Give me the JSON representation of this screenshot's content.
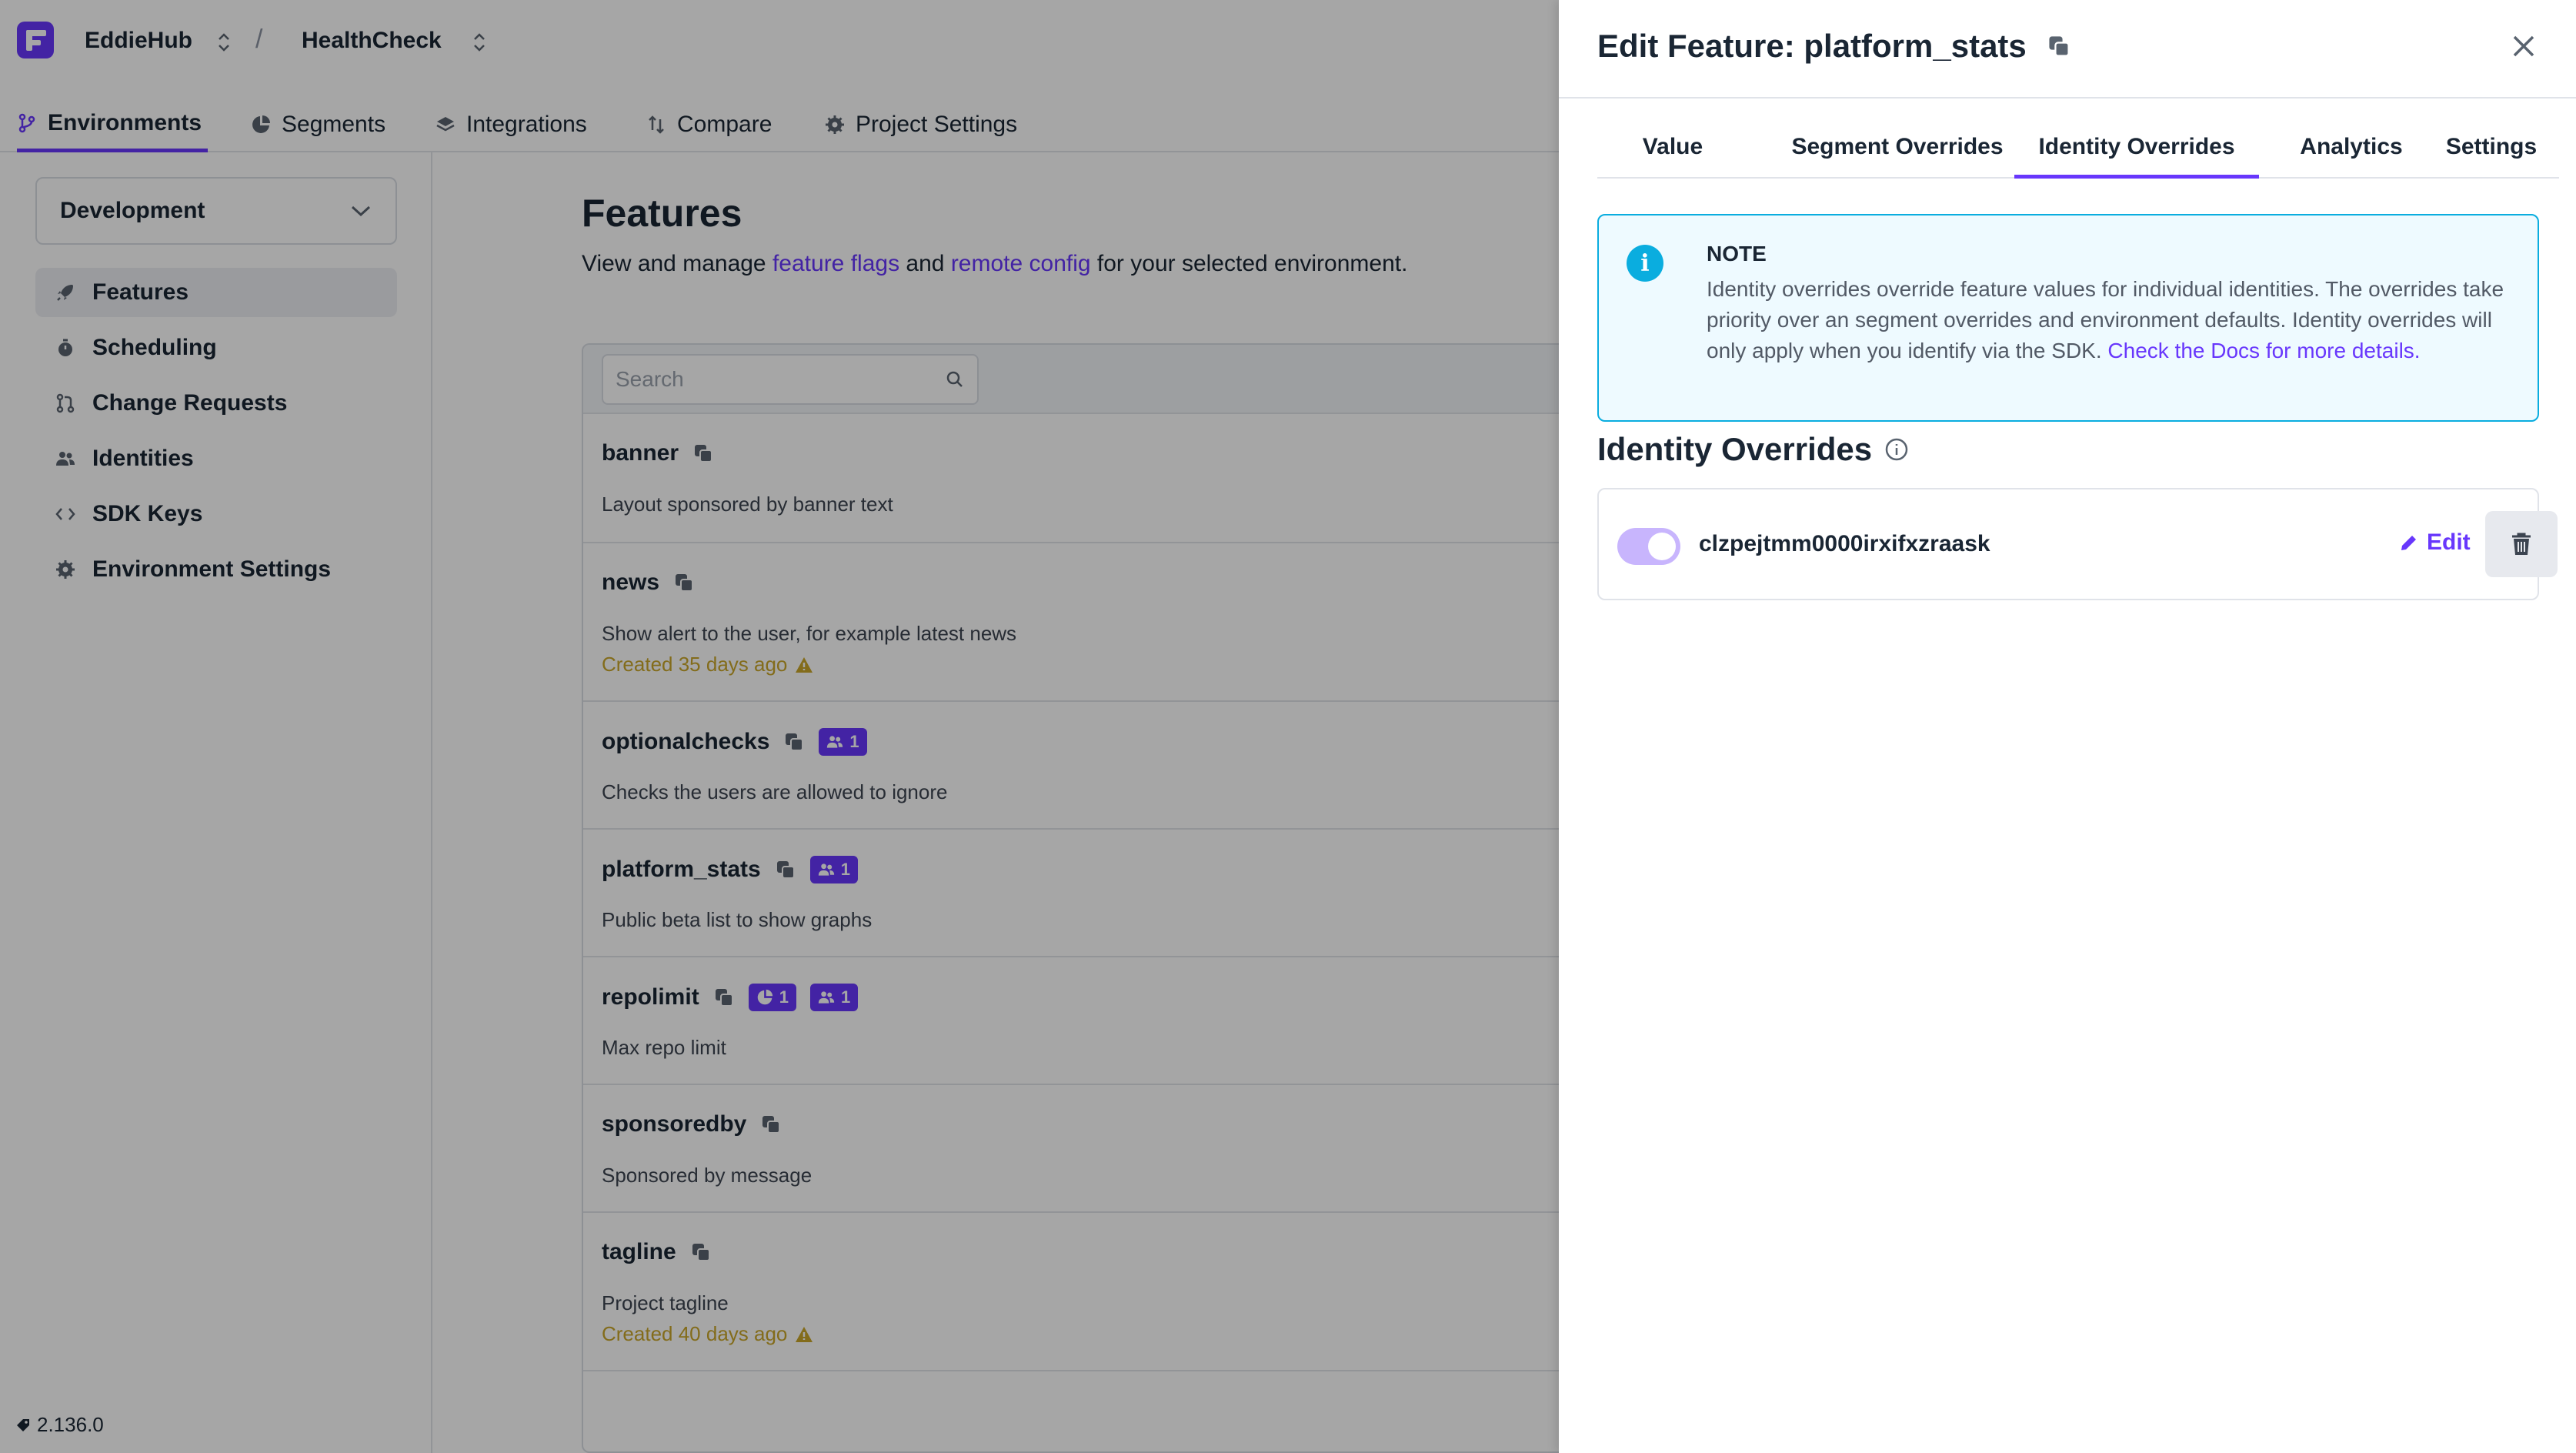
{
  "topbar": {
    "org": "EddieHub",
    "separator": "/",
    "project": "HealthCheck"
  },
  "nav": {
    "tabs": [
      {
        "label": "Environments",
        "icon": "git-branch-icon"
      },
      {
        "label": "Segments",
        "icon": "pie-chart-icon"
      },
      {
        "label": "Integrations",
        "icon": "layers-icon"
      },
      {
        "label": "Compare",
        "icon": "compare-icon"
      },
      {
        "label": "Project Settings",
        "icon": "gear-icon"
      }
    ]
  },
  "sidebar": {
    "environment": "Development",
    "items": [
      {
        "label": "Features",
        "icon": "rocket-icon"
      },
      {
        "label": "Scheduling",
        "icon": "timer-icon"
      },
      {
        "label": "Change Requests",
        "icon": "pull-request-icon"
      },
      {
        "label": "Identities",
        "icon": "people-icon"
      },
      {
        "label": "SDK Keys",
        "icon": "code-icon"
      },
      {
        "label": "Environment Settings",
        "icon": "gear-icon"
      }
    ],
    "version": "2.136.0"
  },
  "main": {
    "title": "Features",
    "subtitle_pre": "View and manage ",
    "link1": "feature flags",
    "subtitle_mid": " and ",
    "link2": "remote config",
    "subtitle_post": " for your selected environment.",
    "search_placeholder": "Search",
    "features": [
      {
        "name": "banner",
        "description": "Layout sponsored by banner text"
      },
      {
        "name": "news",
        "description": "Show alert to the user, for example latest news",
        "meta": "Created 35 days ago"
      },
      {
        "name": "optionalchecks",
        "description": "Checks the users are allowed to ignore",
        "identity_overrides": "1"
      },
      {
        "name": "platform_stats",
        "description": "Public beta list to show graphs",
        "identity_overrides": "1"
      },
      {
        "name": "repolimit",
        "description": "Max repo limit",
        "segment_overrides": "1",
        "identity_overrides": "1"
      },
      {
        "name": "sponsoredby",
        "description": "Sponsored by message"
      },
      {
        "name": "tagline",
        "description": "Project tagline",
        "meta": "Created 40 days ago"
      }
    ]
  },
  "drawer": {
    "title": "Edit Feature: platform_stats",
    "tabs": [
      "Value",
      "Segment Overrides",
      "Identity Overrides",
      "Analytics",
      "Settings"
    ],
    "active_tab": "Identity Overrides",
    "note": {
      "title": "NOTE",
      "body": "Identity overrides override feature values for individual identities. The overrides take priority over an segment overrides and environment defaults. Identity overrides will only apply when you identify via the SDK. ",
      "link": "Check the Docs for more details."
    },
    "section_title": "Identity Overrides",
    "override": {
      "identity": "clzpejtmm0000irxifxzraask",
      "enabled": true,
      "edit_label": "Edit"
    }
  },
  "colors": {
    "accent": "#6837fc",
    "info": "#0aaddf",
    "warning": "#c9a72a"
  }
}
